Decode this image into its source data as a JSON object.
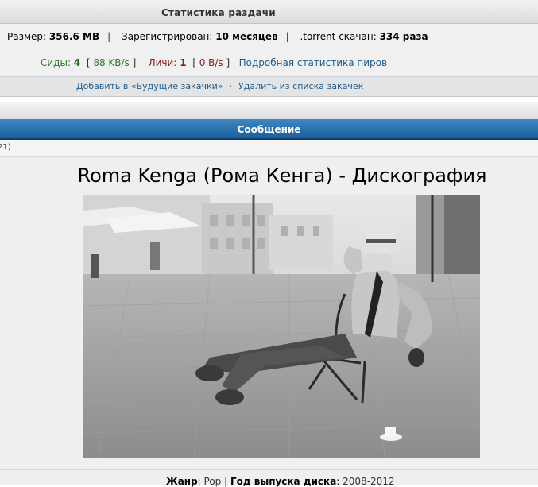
{
  "stats": {
    "header": "Статистика раздачи",
    "size_label": "Размер:",
    "size_value": "356.6 MB",
    "registered_label": "Зарегистрирован:",
    "registered_value": "10 месяцев",
    "downloaded_label": ".torrent скачан:",
    "downloaded_value": "334 раза",
    "seeds_label": "Сиды:",
    "seeds_count": "4",
    "seeds_speed": "88 KB/s",
    "leechers_label": "Личи:",
    "leechers_count": "1",
    "leechers_speed": "0 B/s",
    "peer_stats_link": "Подробная статистика пиров",
    "add_future_link": "Добавить в «Будущие закачки»",
    "remove_link": "Удалить из списка закачек"
  },
  "message": {
    "header": "Сообщение",
    "post_number": "21)",
    "title": "Roma Kenga (Рома Кенга) - Дискография"
  },
  "footer": {
    "genre_label": "Жанр",
    "genre_value": "Pop",
    "year_label": "Год выпуска диска",
    "year_value": "2008-2012"
  },
  "colors": {
    "accent": "#1a5f9c",
    "seed": "#2c7a23",
    "leech": "#8b1a1a",
    "link": "#1f5c8c"
  }
}
